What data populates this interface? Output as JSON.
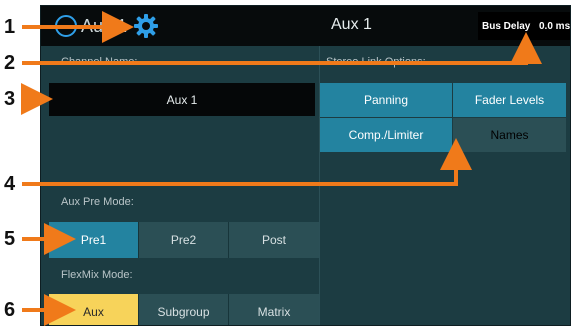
{
  "header": {
    "channel_label": "Aux 1",
    "title": "Aux 1",
    "bus_delay_label": "Bus Delay",
    "bus_delay_value": "0.0 ms"
  },
  "channel_name": {
    "label": "Channel Name:",
    "value": "Aux 1"
  },
  "stereo_link": {
    "label": "Stereo Link Options:",
    "options": [
      {
        "label": "Panning",
        "active": true
      },
      {
        "label": "Fader Levels",
        "active": true
      },
      {
        "label": "Comp./Limiter",
        "active": true
      },
      {
        "label": "Names",
        "active": false
      }
    ]
  },
  "aux_pre_mode": {
    "label": "Aux Pre Mode:",
    "options": [
      "Pre1",
      "Pre2",
      "Post"
    ],
    "selected": "Pre1"
  },
  "flexmix_mode": {
    "label": "FlexMix Mode:",
    "options": [
      "Aux",
      "Subgroup",
      "Matrix"
    ],
    "selected": "Aux"
  },
  "callouts": [
    "1",
    "2",
    "3",
    "4",
    "5",
    "6"
  ],
  "colors": {
    "accent_blue": "#2383a0",
    "accent_yellow": "#f7d35a",
    "arrow_orange": "#f07a1a",
    "panel": "#1c3c42"
  }
}
